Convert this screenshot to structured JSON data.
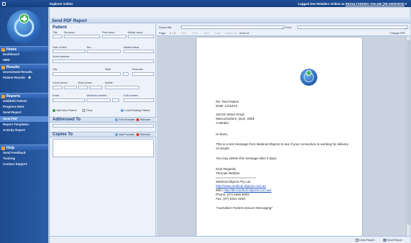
{
  "topbar": {
    "app_title": "Explorer Online",
    "user_prefix": "Logged into Retailers Online as",
    "user_link": "RESULTSDEMO ONLINE (RE-E6000000)",
    "user_caret": "▾"
  },
  "sidebar": {
    "sections": [
      {
        "title": "Home",
        "items": [
          {
            "label": "Dashboard"
          },
          {
            "label": "SMD"
          }
        ]
      },
      {
        "title": "Results",
        "items": [
          {
            "label": "Unreviewed Results"
          },
          {
            "label": "Patient Results",
            "badge": "✱"
          }
        ]
      },
      {
        "title": "Reports",
        "items": [
          {
            "label": "Add/Edit Patient"
          },
          {
            "label": "Progress Note"
          },
          {
            "label": "Send Report"
          },
          {
            "label": "Send PDF",
            "active": true
          },
          {
            "label": "Report Templates"
          },
          {
            "label": "Activity Report"
          }
        ]
      },
      {
        "title": "Help",
        "items": [
          {
            "label": "Send Feedback"
          },
          {
            "label": "Training"
          },
          {
            "label": "Contact Support"
          }
        ]
      }
    ]
  },
  "main": {
    "title": "Send PDF Report",
    "patient": {
      "heading": "Patient",
      "labels": {
        "title": "Title:",
        "surname": "Surname:",
        "first_name": "First name:",
        "middle_name": "Middle name:",
        "dob": "Date of birth:",
        "sex": "Sex:",
        "marital": "Marital status:",
        "street": "Street address:",
        "city": "City:",
        "state": "State",
        "postcode": "Postcode:",
        "home_phone": "Home phone:",
        "work_phone": "Work phone:",
        "mobile": "Mobile:",
        "email": "Email:",
        "medicare": "Medicare number:",
        "dva": "DVA number:"
      },
      "add_new": "Add New Patient",
      "clear": "Clear",
      "load_existing": "Load Existing Patient"
    },
    "addressed_to": {
      "heading": "Addressed To",
      "find": "Find Provider",
      "remove": "Remove"
    },
    "copies_to": {
      "heading": "Copies To",
      "add": "Add Provider",
      "remove": "Remove"
    }
  },
  "preview": {
    "report_title_label": "Report title:",
    "from_label": "From:",
    "toolbar": {
      "page": "Page:",
      "page_num": "1",
      "of": "/ 1",
      "first": "First",
      "prev": "Prev",
      "next": "Next",
      "last": "Last",
      "zoom_out": "Zoom Out",
      "zoom_in": "Zoom In",
      "change_pdf": "Change PDF"
    },
    "letter": {
      "re": "Re: Test Patient",
      "dob": "DOB: 12/12/12",
      "addr1": "15/102 Wises Road",
      "addr2": "Maroochydore, QLD, 4558",
      "addr3": "Australia",
      "greeting": "Hi there,",
      "body1": "This is a test message from Medical-Objects to see if your connection is working for delivery",
      "body2": "of results.",
      "body3": "You may delete this message after 2 days.",
      "regards": "Kind Regards,",
      "name": "Thomas Webber",
      "rule": "=====================",
      "company": "Medical-Objects Pty Ltd",
      "url": "http://www.medical-objects.com.au",
      "wiki_label": "Wiki:",
      "wiki_url": "http://kb.medical-objects.com.au/",
      "phone": "Phone. (07) 5456 6000",
      "fax": "Fax. (07) 5221 0220",
      "tagline": "\"Australia's Fastest Secure Messaging\""
    }
  },
  "footer": {
    "clear_report": "Clear Report",
    "send_report": "Send Report"
  },
  "colors": {
    "accent": "#1f4f98",
    "sidebar": "#2a5ca6",
    "active": "#5d8fd6",
    "link": "#1b4fc2"
  }
}
